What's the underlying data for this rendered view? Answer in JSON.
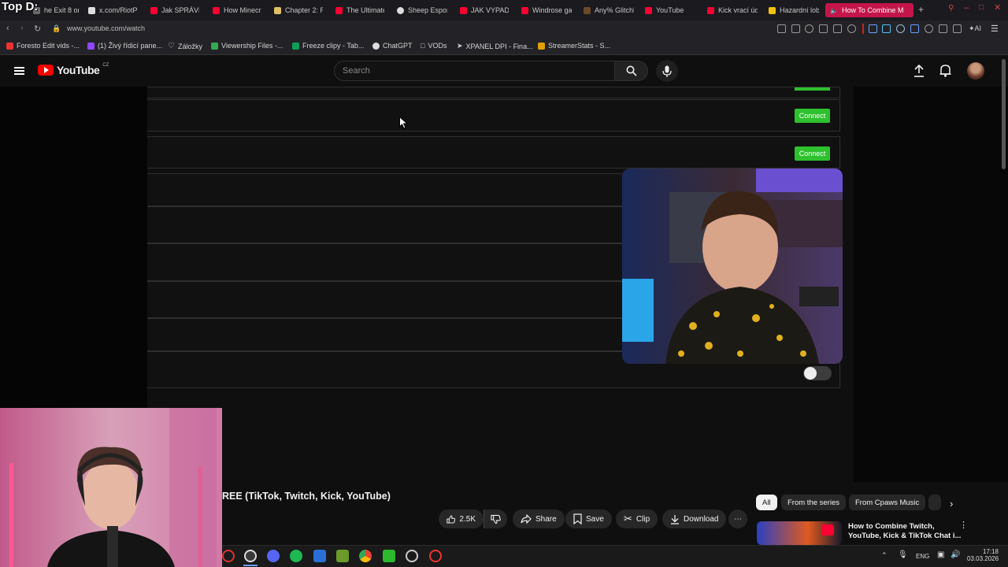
{
  "overlay_label": "Top D:",
  "browser": {
    "tabs": [
      {
        "label": "he Exit 8 on",
        "color": "#6b6b6b"
      },
      {
        "label": "x.com/RiotPl",
        "color": "#dddddd"
      },
      {
        "label": "Jak SPRÁVNĚ",
        "color": "#ff0033"
      },
      {
        "label": "How Minecra",
        "color": "#ff0033"
      },
      {
        "label": "Chapter 2: R",
        "color": "#e0c060"
      },
      {
        "label": "The Ultimate",
        "color": "#ff0033"
      },
      {
        "label": "Sheep Espor",
        "color": "#dddddd"
      },
      {
        "label": "JAK VYPADÁ",
        "color": "#ff0033"
      },
      {
        "label": "Windrose ga",
        "color": "#ff0033"
      },
      {
        "label": "Any% Glitchl",
        "color": "#6b4a2a"
      },
      {
        "label": "YouTube",
        "color": "#ff0033"
      },
      {
        "label": "Kick vrací úd",
        "color": "#ff0033"
      },
      {
        "label": "Hazardní lob",
        "color": "#f4c20d"
      },
      {
        "label": "How To Combine M",
        "color": "#ffffff"
      }
    ],
    "url": "www.youtube.com/watch",
    "bookmarks": [
      {
        "label": "Foresto Edit vids -...",
        "color": "#e33"
      },
      {
        "label": "(1) Živý řídicí pane...",
        "color": "#9146ff"
      },
      {
        "label": "Záložky",
        "color": "#cccccc"
      },
      {
        "label": "Viewership Files -...",
        "color": "#34a853"
      },
      {
        "label": "Freeze clipy - Tab...",
        "color": "#0f9d58"
      },
      {
        "label": "ChatGPT",
        "color": "#dddddd"
      },
      {
        "label": "VODs",
        "color": "#bbbbbb"
      },
      {
        "label": "XPANEL DPI - Fina...",
        "color": "#dddddd"
      },
      {
        "label": "StreamerStats - S...",
        "color": "#e0a000"
      }
    ]
  },
  "youtube": {
    "logo_text": "YouTube",
    "country_code": "CZ",
    "search_placeholder": "Search"
  },
  "video": {
    "connect_label": "Connect",
    "title": "REE (TikTok, Twitch, Kick, YouTube)"
  },
  "actions": {
    "likes": "2.5K",
    "share": "Share",
    "save": "Save",
    "clip": "Clip",
    "download": "Download"
  },
  "chips": [
    "All",
    "From the series",
    "From Cpaws Music"
  ],
  "related": {
    "title_line1": "How to Combine Twitch,",
    "title_line2": "YouTube, Kick & TikTok Chat i..."
  },
  "taskbar": {
    "lang": "ENG",
    "time": "17:18",
    "date": "03.03.2026"
  }
}
